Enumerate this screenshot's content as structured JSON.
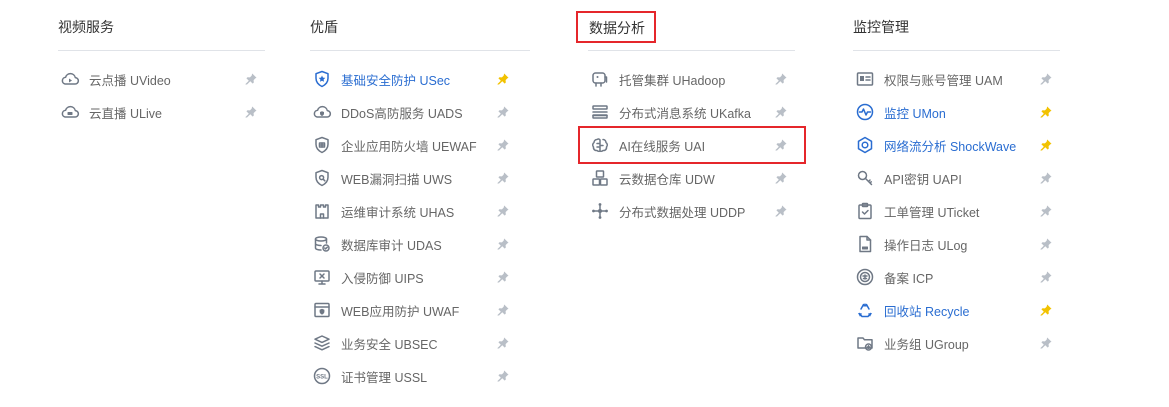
{
  "colors": {
    "text": "#666666",
    "active_text": "#2a6dd1",
    "title": "#333333",
    "highlight_border": "#e5262b",
    "pin_gray": "#b9bfc7",
    "pin_active": "#f2c200",
    "icon_gray": "#6f7885",
    "icon_blue": "#2a6dd1"
  },
  "columns": [
    {
      "title": "视频服务",
      "items": [
        {
          "label": "云点播  UVideo",
          "icon": "cloud-play-icon",
          "active": false,
          "pinned": false
        },
        {
          "label": "云直播  ULive",
          "icon": "cloud-live-icon",
          "active": false,
          "pinned": false
        }
      ]
    },
    {
      "title": "优盾",
      "items": [
        {
          "label": "基础安全防护  USec",
          "icon": "shield-star-icon",
          "active": true,
          "pinned": true
        },
        {
          "label": "DDoS高防服务  UADS",
          "icon": "cloud-shield-icon",
          "active": false,
          "pinned": false
        },
        {
          "label": "企业应用防火墙  UEWAF",
          "icon": "shield-wall-icon",
          "active": false,
          "pinned": false
        },
        {
          "label": "WEB漏洞扫描  UWS",
          "icon": "shield-search-icon",
          "active": false,
          "pinned": false
        },
        {
          "label": "运维审计系统  UHAS",
          "icon": "castle-icon",
          "active": false,
          "pinned": false
        },
        {
          "label": "数据库审计  UDAS",
          "icon": "database-check-icon",
          "active": false,
          "pinned": false
        },
        {
          "label": "入侵防御  UIPS",
          "icon": "monitor-x-icon",
          "active": false,
          "pinned": false
        },
        {
          "label": "WEB应用防护  UWAF",
          "icon": "browser-shield-icon",
          "active": false,
          "pinned": false
        },
        {
          "label": "业务安全  UBSEC",
          "icon": "layers-shield-icon",
          "active": false,
          "pinned": false
        },
        {
          "label": "证书管理  USSL",
          "icon": "ssl-icon",
          "active": false,
          "pinned": false
        }
      ]
    },
    {
      "title": "数据分析",
      "items": [
        {
          "label": "托管集群  UHadoop",
          "icon": "elephant-icon",
          "active": false,
          "pinned": false
        },
        {
          "label": "分布式消息系统  UKafka",
          "icon": "message-queue-icon",
          "active": false,
          "pinned": false
        },
        {
          "label": "AI在线服务  UAI",
          "icon": "brain-icon",
          "active": false,
          "pinned": false
        },
        {
          "label": "云数据仓库  UDW",
          "icon": "warehouse-icon",
          "active": false,
          "pinned": false
        },
        {
          "label": "分布式数据处理  UDDP",
          "icon": "network-nodes-icon",
          "active": false,
          "pinned": false
        }
      ]
    },
    {
      "title": "监控管理",
      "items": [
        {
          "label": "权限与账号管理  UAM",
          "icon": "id-card-icon",
          "active": false,
          "pinned": false
        },
        {
          "label": "监控  UMon",
          "icon": "pulse-icon",
          "active": true,
          "pinned": true
        },
        {
          "label": "网络流分析  ShockWave",
          "icon": "wave-ring-icon",
          "active": true,
          "pinned": true
        },
        {
          "label": "API密钥  UAPI",
          "icon": "key-icon",
          "active": false,
          "pinned": false
        },
        {
          "label": "工单管理  UTicket",
          "icon": "clipboard-icon",
          "active": false,
          "pinned": false
        },
        {
          "label": "操作日志  ULog",
          "icon": "log-file-icon",
          "active": false,
          "pinned": false
        },
        {
          "label": "备案  ICP",
          "icon": "seal-icon",
          "active": false,
          "pinned": false
        },
        {
          "label": "回收站  Recycle",
          "icon": "recycle-icon",
          "active": true,
          "pinned": true
        },
        {
          "label": "业务组  UGroup",
          "icon": "folder-group-icon",
          "active": false,
          "pinned": false
        }
      ]
    }
  ]
}
